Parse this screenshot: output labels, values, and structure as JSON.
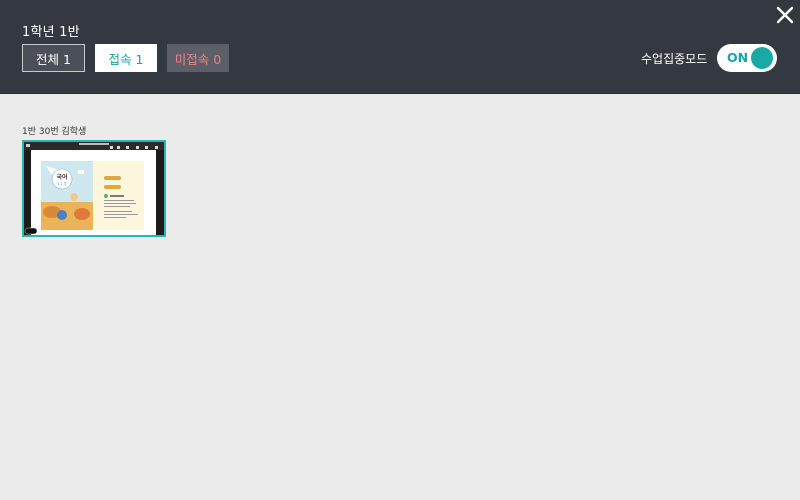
{
  "header": {
    "class_title": "1학년 1반",
    "filters": {
      "all_label": "전체 1",
      "connected_label": "접속 1",
      "disconnected_label": "미접속 0"
    },
    "focus_mode_label": "수업집중모드",
    "focus_mode_state": "ON"
  },
  "students": [
    {
      "name": "1반 30번 김학생",
      "screen": {
        "book_title": "국어",
        "book_subtitle": "1-1 가"
      }
    }
  ],
  "colors": {
    "header_bg": "#343841",
    "page_bg": "#ebebeb",
    "accent_teal": "#1aa0a6",
    "disconnected_red": "#f08080"
  }
}
